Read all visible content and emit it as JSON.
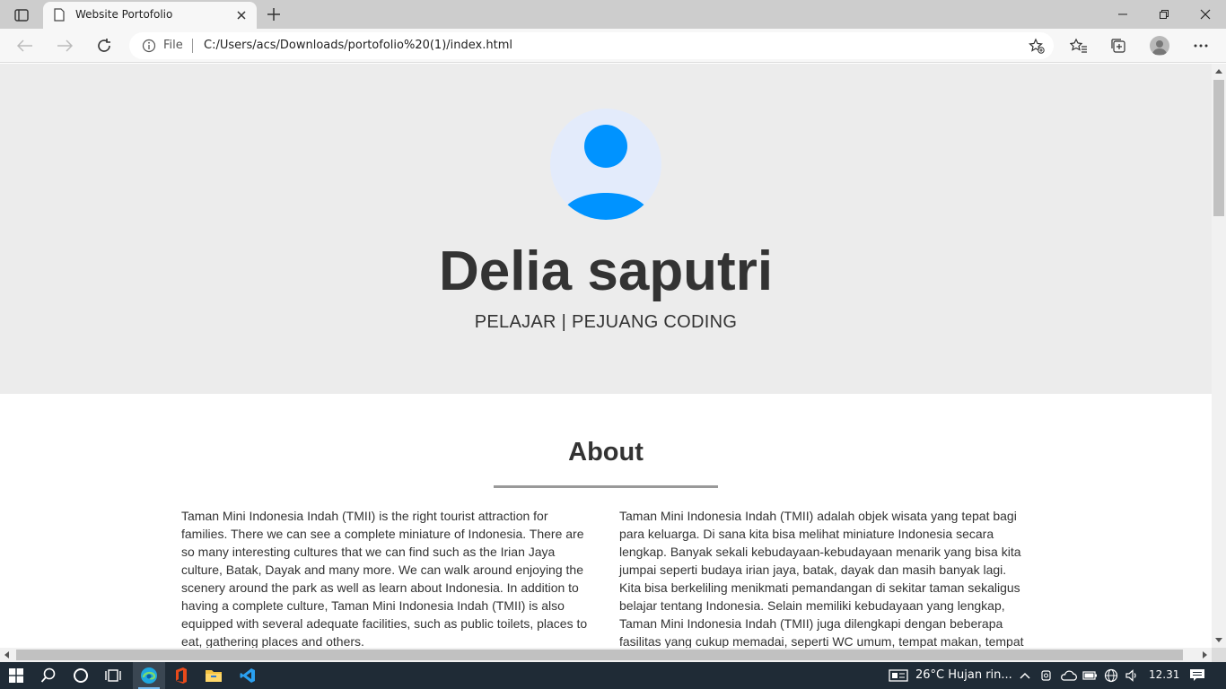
{
  "browser": {
    "tab_title": "Website Portofolio",
    "url_scheme_label": "File",
    "url": "C:/Users/acs/Downloads/portofolio%20(1)/index.html"
  },
  "hero": {
    "name": "Delia saputri",
    "subtitle": "PELAJAR | PEJUANG CODING",
    "avatar_colors": {
      "background": "#e3ebfb",
      "figure": "#0093ff"
    }
  },
  "about": {
    "title": "About",
    "left_text": "Taman Mini Indonesia Indah (TMII) is the right tourist attraction for families. There we can see a complete miniature of Indonesia. There are so many interesting cultures that we can find such as the Irian Jaya culture, Batak, Dayak and many more. We can walk around enjoying the scenery around the park as well as learn about Indonesia. In addition to having a complete culture, Taman Mini Indonesia Indah (TMII) is also equipped with several adequate facilities, such as public toilets, places to eat, gathering places and others.",
    "right_text": "Taman Mini Indonesia Indah (TMII) adalah objek wisata yang tepat bagi para keluarga. Di sana kita bisa melihat miniature Indonesia secara lengkap. Banyak sekali kebudayaan-kebudayaan menarik yang bisa kita jumpai seperti budaya irian jaya, batak, dayak dan masih banyak lagi. Kita bisa berkeliling menikmati pemandangan di sekitar taman sekaligus belajar tentang Indonesia. Selain memiliki kebudayaan yang lengkap, Taman Mini Indonesia Indah (TMII) juga dilengkapi dengan beberapa fasilitas yang cukup memadai, seperti WC umum, tempat makan, tempat"
  },
  "taskbar": {
    "weather": "26°C  Hujan rin...",
    "time": "12.31"
  }
}
